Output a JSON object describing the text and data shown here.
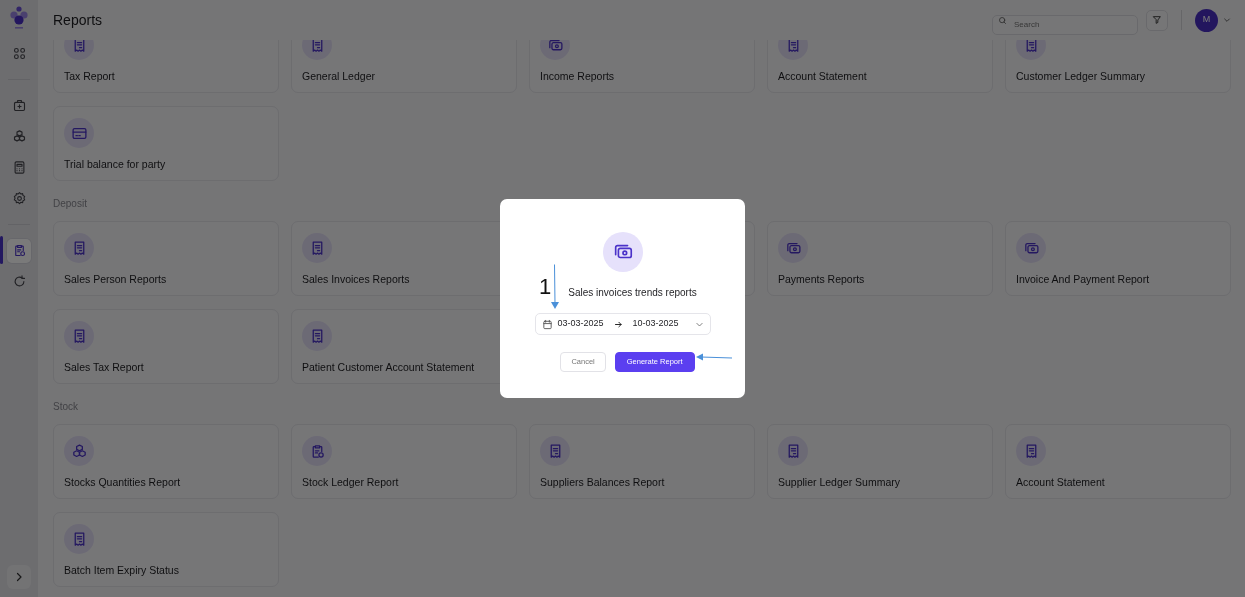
{
  "sidebar": {
    "items": [
      {
        "kind": "apps",
        "selected": false
      },
      {
        "kind": "divider"
      },
      {
        "kind": "medkit",
        "selected": false
      },
      {
        "kind": "cubes",
        "selected": false
      },
      {
        "kind": "calculator",
        "selected": false
      },
      {
        "kind": "gear",
        "selected": false
      },
      {
        "kind": "divider"
      },
      {
        "kind": "clipboard",
        "selected": true
      },
      {
        "kind": "refresh",
        "selected": false
      }
    ]
  },
  "header": {
    "title": "Reports",
    "search": {
      "placeholder": "Search"
    },
    "avatar": "M"
  },
  "sections": [
    {
      "cards": [
        {
          "label": "Tax Report",
          "kind": "receipt"
        },
        {
          "label": "General Ledger",
          "kind": "receipt"
        },
        {
          "label": "Income Reports",
          "kind": "cash"
        },
        {
          "label": "Account Statement",
          "kind": "receipt"
        },
        {
          "label": "Customer Ledger Summary",
          "kind": "receipt"
        },
        {
          "label": "Trial balance for party",
          "kind": "card"
        }
      ]
    },
    {
      "title": "Deposit",
      "cards": [
        {
          "label": "Sales Person Reports",
          "kind": "receipt"
        },
        {
          "label": "Sales Invoices Reports",
          "kind": "receipt"
        },
        {
          "kind": "covered"
        },
        {
          "label": "Payments Reports",
          "kind": "cash"
        },
        {
          "label": "Invoice And Payment Report",
          "kind": "cash"
        },
        {
          "label": "Sales Tax Report",
          "kind": "receipt"
        },
        {
          "label": "Patient Customer Account Statement",
          "kind": "receipt"
        }
      ]
    },
    {
      "title": "Stock",
      "cards": [
        {
          "label": "Stocks Quantities Report",
          "kind": "cubes"
        },
        {
          "label": "Stock Ledger Report",
          "kind": "clipboard"
        },
        {
          "label": "Suppliers Balances Report",
          "kind": "receipt"
        },
        {
          "label": "Supplier Ledger Summary",
          "kind": "receipt"
        },
        {
          "label": "Account Statement",
          "kind": "receipt"
        },
        {
          "label": "Batch Item Expiry Status",
          "kind": "receipt"
        }
      ]
    }
  ],
  "modal": {
    "title": "Sales invoices trends reports",
    "date_from": "03-03-2025",
    "date_to": "10-03-2025",
    "buttons": [
      {
        "label": "Cancel",
        "kind": "secondary"
      },
      {
        "label": "Generate Report",
        "kind": "primary"
      }
    ]
  },
  "annotation": {
    "label": "1"
  }
}
